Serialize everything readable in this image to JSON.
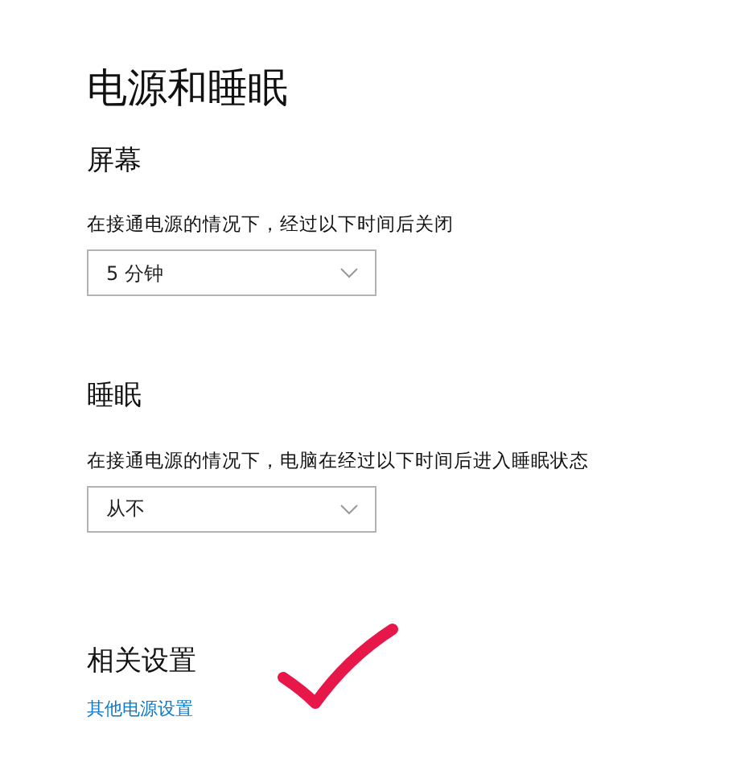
{
  "page": {
    "title": "电源和睡眠"
  },
  "sections": [
    {
      "heading": "屏幕",
      "description": "在接通电源的情况下，经过以下时间后关闭",
      "dropdown": {
        "value": "5 分钟"
      }
    },
    {
      "heading": "睡眠",
      "description": "在接通电源的情况下，电脑在经过以下时间后进入睡眠状态",
      "dropdown": {
        "value": "从不"
      }
    }
  ],
  "related": {
    "heading": "相关设置",
    "link": "其他电源设置"
  },
  "annotation": {
    "kind": "checkmark",
    "color": "#e8174a"
  }
}
